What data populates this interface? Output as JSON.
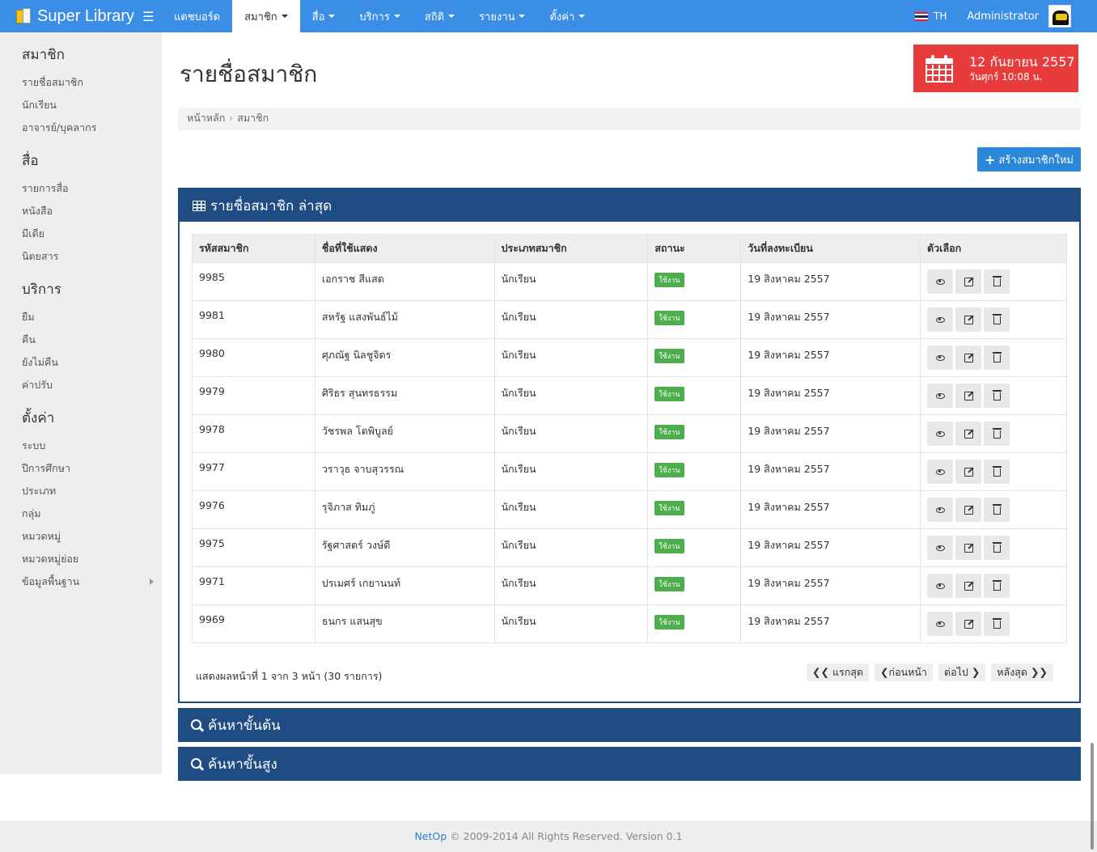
{
  "navbar": {
    "brand": "Super Library",
    "items": [
      {
        "label": "แดชบอร์ด",
        "caret": false,
        "active": false
      },
      {
        "label": "สมาชิก",
        "caret": true,
        "active": true
      },
      {
        "label": "สื่อ",
        "caret": true,
        "active": false
      },
      {
        "label": "บริการ",
        "caret": true,
        "active": false
      },
      {
        "label": "สถิติ",
        "caret": true,
        "active": false
      },
      {
        "label": "รายงาน",
        "caret": true,
        "active": false
      },
      {
        "label": "ตั้งค่า",
        "caret": true,
        "active": false
      }
    ],
    "lang": "TH",
    "user": "Administrator"
  },
  "sidebar": {
    "groups": [
      {
        "title": "สมาชิก",
        "items": [
          "รายชื่อสมาชิก",
          "นักเรียน",
          "อาจารย์/บุคลากร"
        ]
      },
      {
        "title": "สื่อ",
        "items": [
          "รายการสื่อ",
          "หนังสือ",
          "มีเดีย",
          "นิตยสาร"
        ]
      },
      {
        "title": "บริการ",
        "items": [
          "ยืม",
          "คืน",
          "ยังไม่คืน",
          "ค่าปรับ"
        ]
      },
      {
        "title": "ตั้งค่า",
        "items": [
          "ระบบ",
          "ปีการศึกษา",
          "ประเภท",
          "กลุ่ม",
          "หมวดหมู่",
          "หมวดหมู่ย่อย",
          "ข้อมูลพื้นฐาน"
        ]
      }
    ]
  },
  "page": {
    "title": "รายชื่อสมาชิก",
    "date_main": "12 กันยายน 2557",
    "date_sub": "วันศุกร์ 10:08 น.",
    "breadcrumb": [
      "หน้าหลัก",
      "สมาชิก"
    ],
    "create_button": "สร้างสมาชิกใหม่"
  },
  "panel": {
    "title": "รายชื่อสมาชิก ล่าสุด",
    "columns": [
      "รหัสสมาชิก",
      "ชื่อที่ใช้แสดง",
      "ประเภทสมาชิก",
      "สถานะ",
      "วันที่ลงทะเบียน",
      "ตัวเลือก"
    ],
    "rows": [
      {
        "id": "9985",
        "name": "เอกราช สีแสด",
        "type": "นักเรียน",
        "status": "ใช้งาน",
        "date": "19 สิงหาคม 2557"
      },
      {
        "id": "9981",
        "name": "สหรัฐ แสงพันธ์ไม้",
        "type": "นักเรียน",
        "status": "ใช้งาน",
        "date": "19 สิงหาคม 2557"
      },
      {
        "id": "9980",
        "name": "ศุภณัฐ นิลชูจิตร",
        "type": "นักเรียน",
        "status": "ใช้งาน",
        "date": "19 สิงหาคม 2557"
      },
      {
        "id": "9979",
        "name": "ศิริธร สุนทรธรรม",
        "type": "นักเรียน",
        "status": "ใช้งาน",
        "date": "19 สิงหาคม 2557"
      },
      {
        "id": "9978",
        "name": "วัชรพล โตพิบูลย์",
        "type": "นักเรียน",
        "status": "ใช้งาน",
        "date": "19 สิงหาคม 2557"
      },
      {
        "id": "9977",
        "name": "วราวุธ จาบสุวรรณ",
        "type": "นักเรียน",
        "status": "ใช้งาน",
        "date": "19 สิงหาคม 2557"
      },
      {
        "id": "9976",
        "name": "รุจิภาส ทิมภู่",
        "type": "นักเรียน",
        "status": "ใช้งาน",
        "date": "19 สิงหาคม 2557"
      },
      {
        "id": "9975",
        "name": "รัฐศาสตร์ วงษ์ดี",
        "type": "นักเรียน",
        "status": "ใช้งาน",
        "date": "19 สิงหาคม 2557"
      },
      {
        "id": "9971",
        "name": "ปรเมศร์ เกยานนท์",
        "type": "นักเรียน",
        "status": "ใช้งาน",
        "date": "19 สิงหาคม 2557"
      },
      {
        "id": "9969",
        "name": "ธนกร แสนสุข",
        "type": "นักเรียน",
        "status": "ใช้งาน",
        "date": "19 สิงหาคม 2557"
      }
    ],
    "pager_info": "แสดงผลหน้าที่ 1 จาก 3 หน้า (30 รายการ)",
    "pager": {
      "first": "แรกสุด",
      "prev": "ก่อนหน้า",
      "next": "ต่อไป",
      "last": "หลังสุด"
    }
  },
  "search": {
    "basic": "ค้นหาขั้นต้น",
    "advanced": "ค้นหาขั้นสูง"
  },
  "footer": {
    "link": "NetOp",
    "text": " © 2009-2014 All Rights Reserved. Version 0.1"
  },
  "colors": {
    "navbar": "#3a8ee6",
    "panel": "#1f4c82",
    "date_box": "#e83c3c",
    "badge": "#4cae4c"
  }
}
